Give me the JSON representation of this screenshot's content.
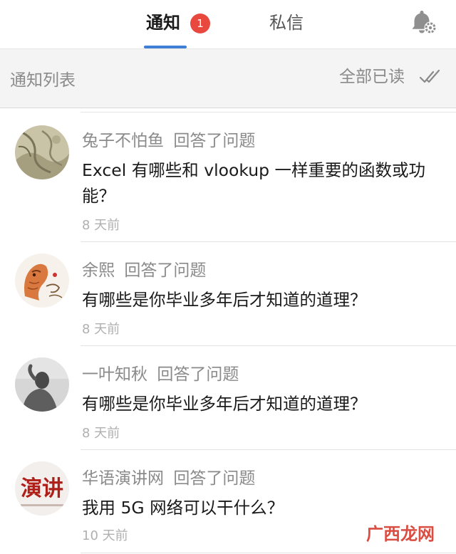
{
  "header": {
    "tab_notify": "通知",
    "badge_count": "1",
    "tab_dm": "私信"
  },
  "list_header": {
    "title": "通知列表",
    "read_all": "全部已读"
  },
  "notifications": [
    {
      "user": "兔子不怕鱼",
      "action": "回答了问题",
      "question": "Excel 有哪些和 vlookup 一样重要的函数或功能？",
      "time": "8 天前"
    },
    {
      "user": "余熙",
      "action": "回答了问题",
      "question": "有哪些是你毕业多年后才知道的道理？",
      "time": "8 天前"
    },
    {
      "user": "一叶知秋",
      "action": "回答了问题",
      "question": "有哪些是你毕业多年后才知道的道理？",
      "time": "8 天前"
    },
    {
      "user": "华语演讲网",
      "action": "回答了问题",
      "question": "我用 5G 网络可以干什么？",
      "time": "10 天前",
      "avatar_text": "演讲"
    }
  ],
  "watermark": "广西龙网",
  "colors": {
    "accent": "#3f7fd6",
    "badge": "#e8483d",
    "muted": "#8a8a8a"
  },
  "icons": [
    "bell-settings-icon",
    "double-check-icon"
  ]
}
